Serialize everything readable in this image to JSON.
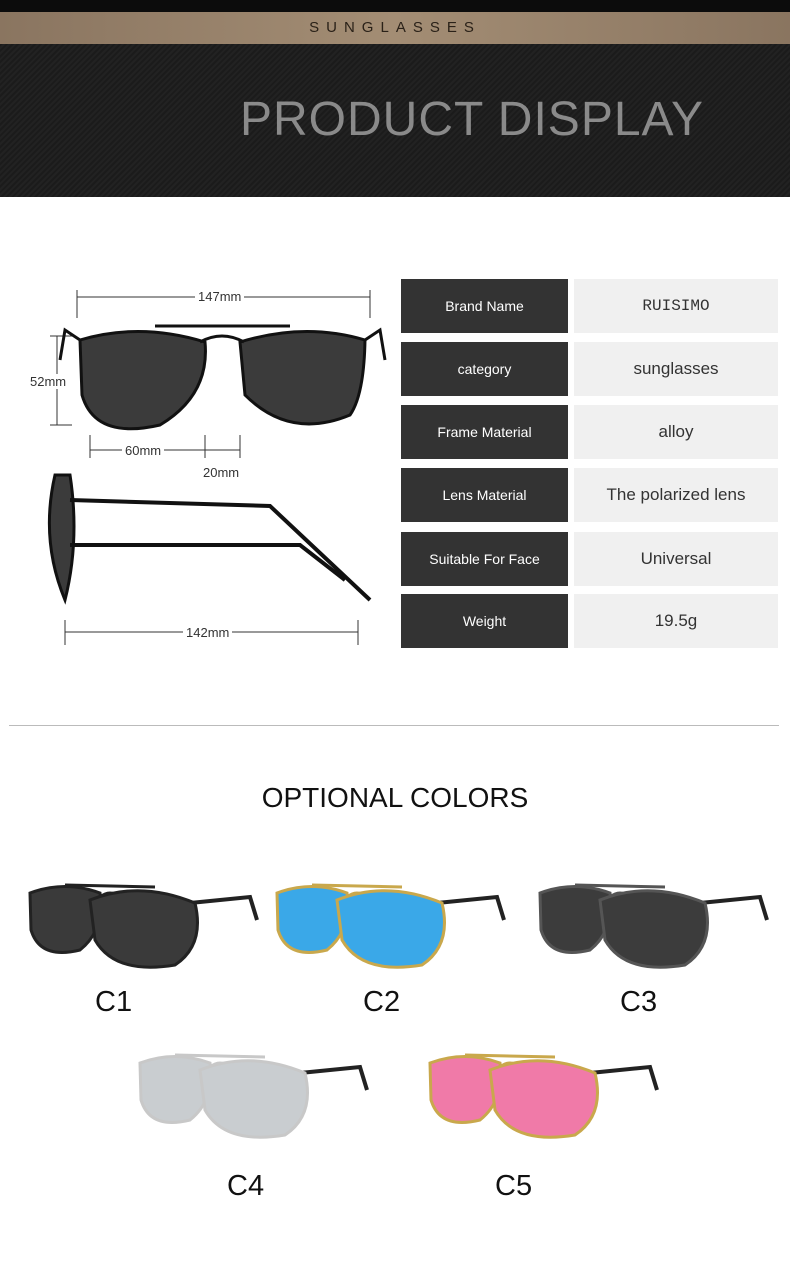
{
  "header": {
    "band_label": "SUNGLASSES",
    "title": "PRODUCT DISPLAY"
  },
  "dimensions": {
    "total_width": "147mm",
    "height": "52mm",
    "lens_width": "60mm",
    "bridge": "20mm",
    "temple_length": "142mm"
  },
  "specs": [
    {
      "label": "Brand Name",
      "value": "RUISIMO"
    },
    {
      "label": "category",
      "value": "sunglasses"
    },
    {
      "label": "Frame Material",
      "value": "alloy"
    },
    {
      "label": "Lens Material",
      "value": "The polarized lens"
    },
    {
      "label": "Suitable For Face",
      "value": "Universal"
    },
    {
      "label": "Weight",
      "value": "19.5g"
    }
  ],
  "optional_colors": {
    "title": "OPTIONAL COLORS",
    "items": [
      {
        "label": "C1",
        "frame": "#222222",
        "lens": "#3a3a3a"
      },
      {
        "label": "C2",
        "frame": "#c9a84c",
        "lens": "#3aa8e8"
      },
      {
        "label": "C3",
        "frame": "#555555",
        "lens": "#3c3c3c"
      },
      {
        "label": "C4",
        "frame": "#c8c8c8",
        "lens": "#c9cdd0"
      },
      {
        "label": "C5",
        "frame": "#c9a84c",
        "lens": "#f07aa8"
      }
    ]
  }
}
